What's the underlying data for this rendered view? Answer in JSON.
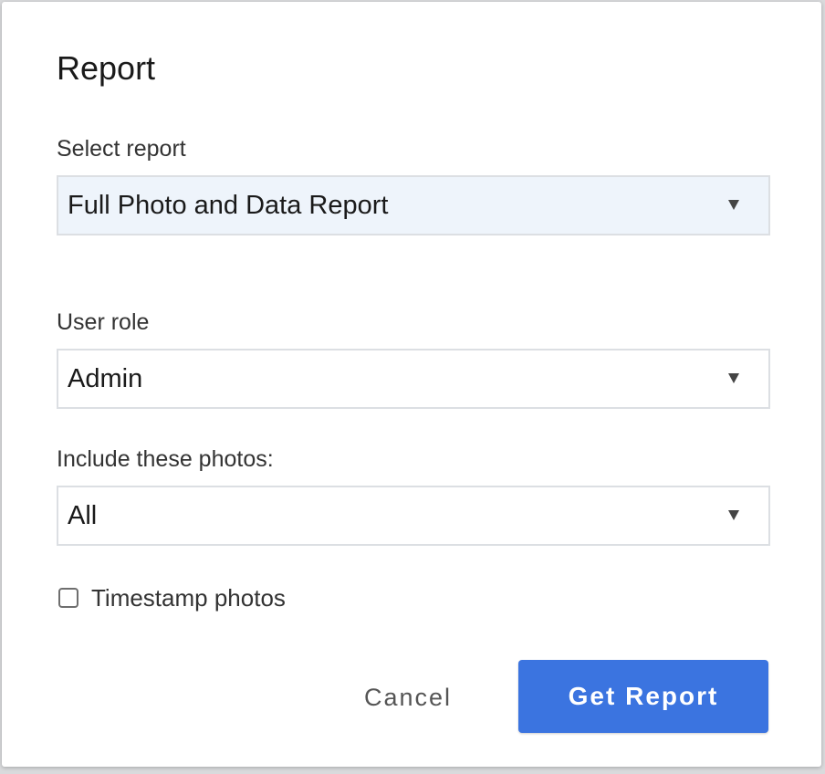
{
  "dialog": {
    "title": "Report",
    "fields": [
      {
        "label": "Select report",
        "value": "Full Photo and Data Report"
      },
      {
        "label": "User role",
        "value": "Admin"
      },
      {
        "label": "Include these photos:",
        "value": "All"
      }
    ],
    "checkbox": {
      "label": "Timestamp photos",
      "checked": false
    },
    "buttons": {
      "cancel": "Cancel",
      "submit": "Get Report"
    }
  },
  "colors": {
    "primary": "#3b74e0",
    "focused_select_bg": "#eef4fb"
  },
  "icons": {
    "select_caret": "caret-down-icon"
  }
}
